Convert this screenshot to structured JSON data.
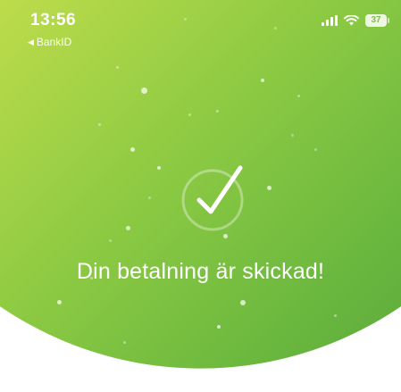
{
  "status_bar": {
    "time": "13:56",
    "back_app": "BankID",
    "battery": "37"
  },
  "confirmation": {
    "icon": "checkmark-icon",
    "message": "Din betalning är skickad!"
  },
  "colors": {
    "gradient_start": "#bddc4b",
    "gradient_end": "#5aaa3b",
    "text": "#ffffff"
  }
}
